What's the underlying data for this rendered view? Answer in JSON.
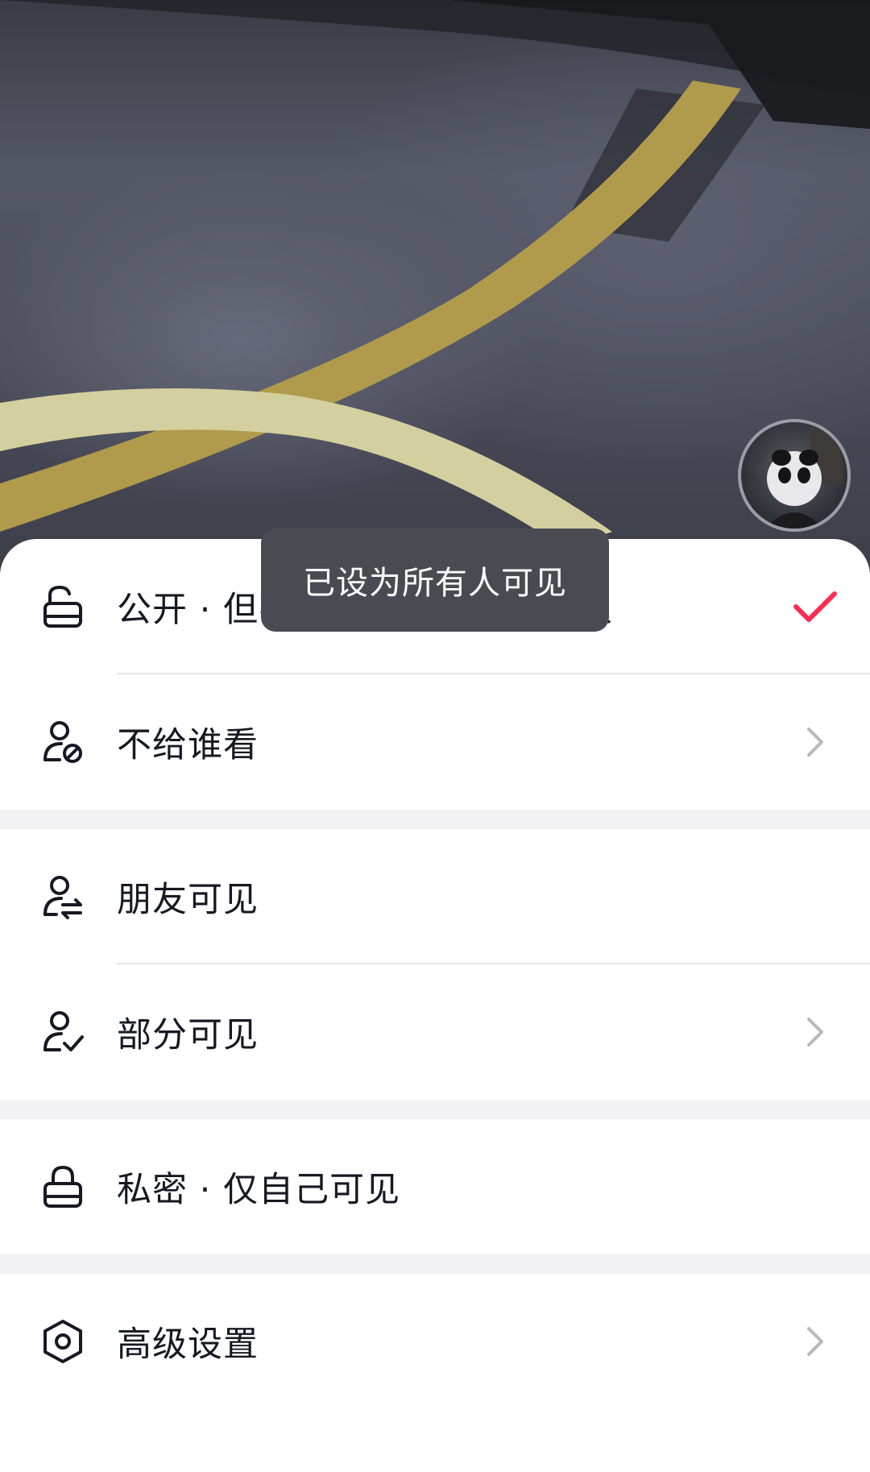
{
  "toast": {
    "text": "已设为所有人可见"
  },
  "options": {
    "public": {
      "label": "公开 · 但不推荐给可能认识的人",
      "selected": true,
      "icon": "unlock-icon",
      "trailing_icon": "checkmark-icon"
    },
    "hide_from": {
      "label": "不给谁看",
      "icon": "user-blocked-icon",
      "trailing_icon": "chevron-right-icon"
    },
    "friends": {
      "label": "朋友可见",
      "icon": "user-exchange-icon"
    },
    "partial": {
      "label": "部分可见",
      "icon": "user-check-icon",
      "trailing_icon": "chevron-right-icon"
    },
    "private": {
      "label": "私密 · 仅自己可见",
      "icon": "lock-icon"
    },
    "advanced": {
      "label": "高级设置",
      "icon": "hexagon-settings-icon",
      "trailing_icon": "chevron-right-icon"
    }
  },
  "colors": {
    "accent_check": "#fe2c55",
    "text_primary": "#161823",
    "chevron": "#b8b9bd",
    "section_gap": "#f2f2f4",
    "toast_bg": "#4a4b52"
  }
}
